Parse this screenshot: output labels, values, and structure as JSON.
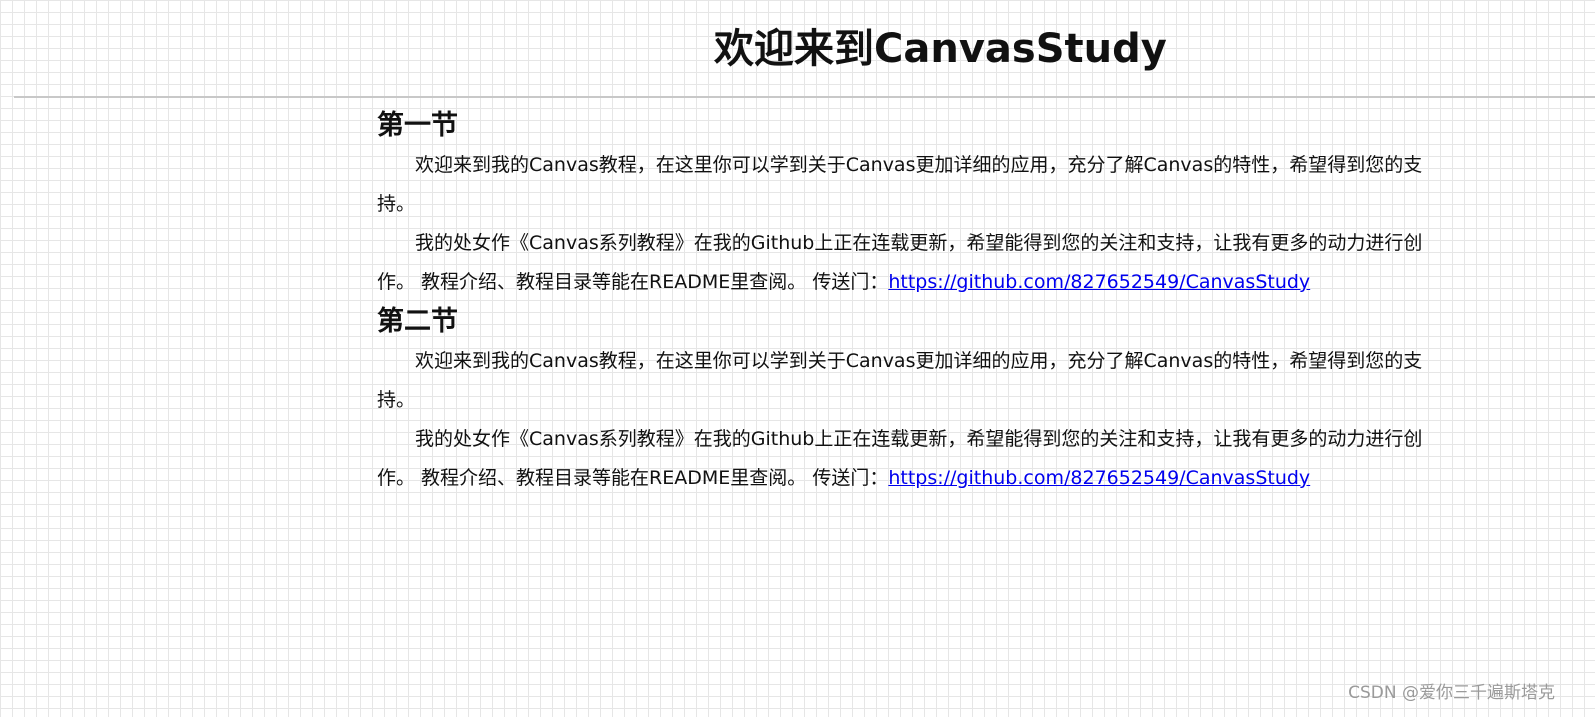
{
  "page": {
    "title": "欢迎来到CanvasStudy"
  },
  "sections": [
    {
      "heading": "第一节",
      "p1": "欢迎来到我的Canvas教程，在这里你可以学到关于Canvas更加详细的应用，充分了解Canvas的特性，希望得到您的支持。",
      "p2_text": "我的处女作《Canvas系列教程》在我的Github上正在连载更新，希望能得到您的关注和支持，让我有更多的动力进行创作。 教程介绍、教程目录等能在README里查阅。 传送门：",
      "p2_link": "https://github.com/827652549/CanvasStudy"
    },
    {
      "heading": "第二节",
      "p1": "欢迎来到我的Canvas教程，在这里你可以学到关于Canvas更加详细的应用，充分了解Canvas的特性，希望得到您的支持。",
      "p2_text": "我的处女作《Canvas系列教程》在我的Github上正在连载更新，希望能得到您的关注和支持，让我有更多的动力进行创作。 教程介绍、教程目录等能在README里查阅。 传送门：",
      "p2_link": "https://github.com/827652549/CanvasStudy"
    }
  ],
  "watermark": "CSDN @爱你三千遍斯塔克",
  "colors": {
    "link": "#0000ee",
    "text": "#111111",
    "grid": "#e6e6e6"
  }
}
